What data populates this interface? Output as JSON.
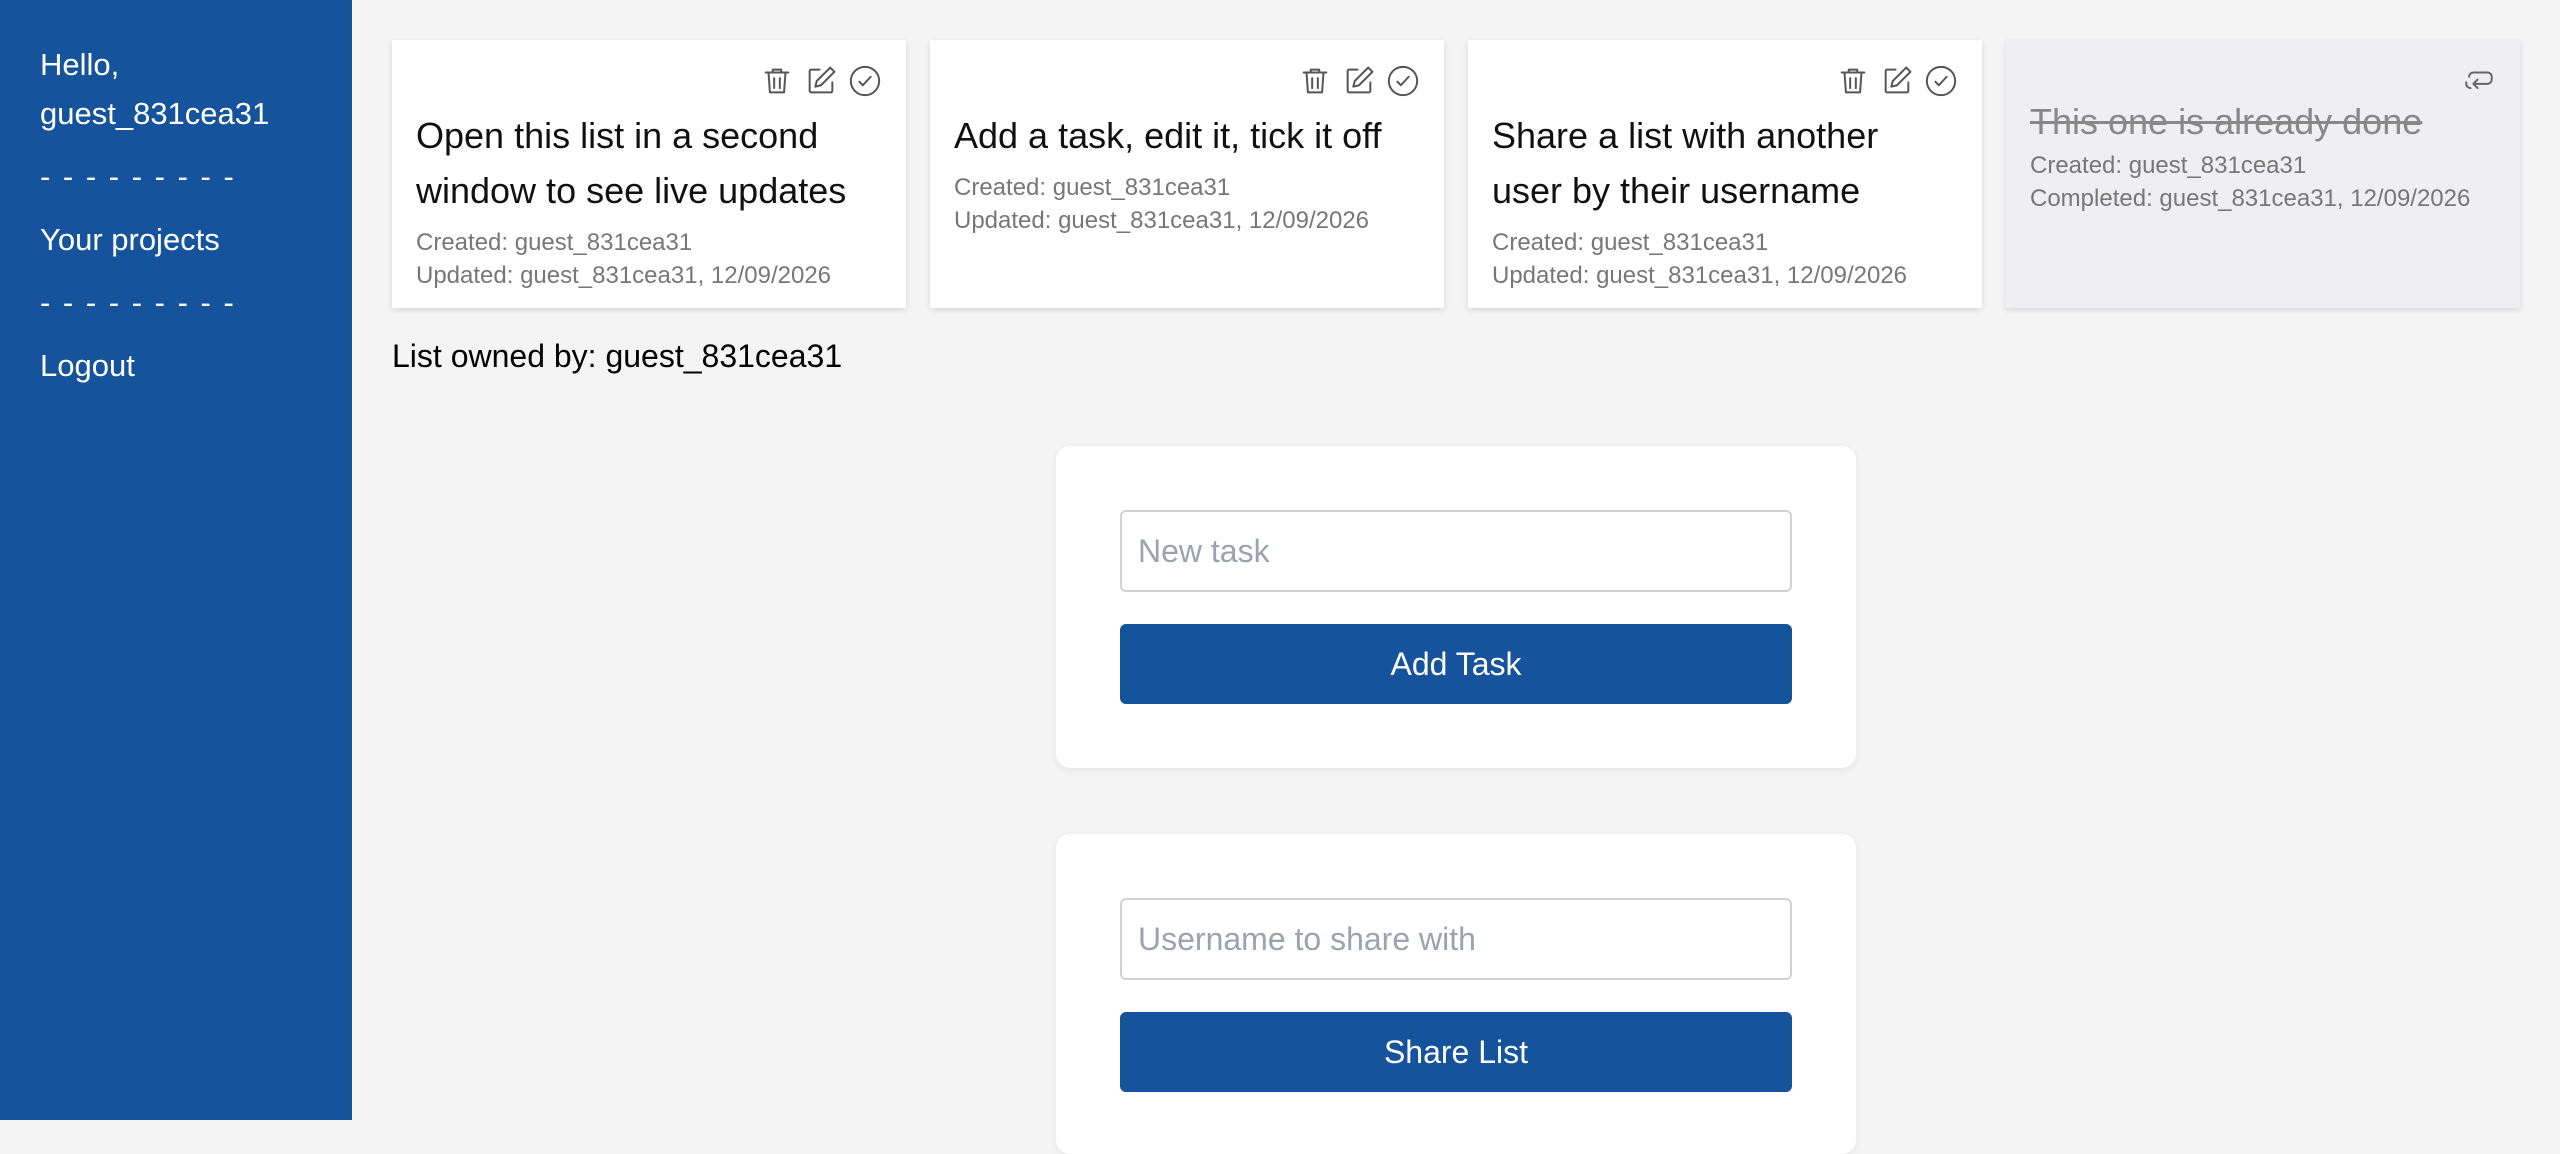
{
  "sidebar": {
    "greeting": "Hello,",
    "username": "guest_831cea31",
    "separator": "- - - - - - - - -",
    "projects_link": "Your projects",
    "logout_link": "Logout"
  },
  "tasks": [
    {
      "title": "Open this list in a second window to see live updates",
      "created": "Created: guest_831cea31",
      "updated": "Updated: guest_831cea31, 12/09/2026",
      "done": false
    },
    {
      "title": "Add a task, edit it, tick it off",
      "created": "Created: guest_831cea31",
      "updated": "Updated: guest_831cea31, 12/09/2026",
      "done": false
    },
    {
      "title": "Share a list with another user by their username",
      "created": "Created: guest_831cea31",
      "updated": "Updated: guest_831cea31, 12/09/2026",
      "done": false
    },
    {
      "title": "This one is already done",
      "created": "Created: guest_831cea31",
      "completed": "Completed: guest_831cea31, 12/09/2026",
      "done": true
    }
  ],
  "owner_text": "List owned by: guest_831cea31",
  "add_task_form": {
    "placeholder": "New task",
    "value": "",
    "button_label": "Add Task"
  },
  "share_form": {
    "placeholder": "Username to share with",
    "value": "",
    "button_label": "Share List"
  },
  "colors": {
    "primary": "#15539c",
    "background": "#f4f4f4",
    "done_card": "#efeff1",
    "meta_text": "#777777"
  },
  "icons": {
    "delete": "trash-icon",
    "edit": "pencil-icon",
    "complete": "check-circle-icon",
    "undo": "undo-arrow-icon"
  }
}
